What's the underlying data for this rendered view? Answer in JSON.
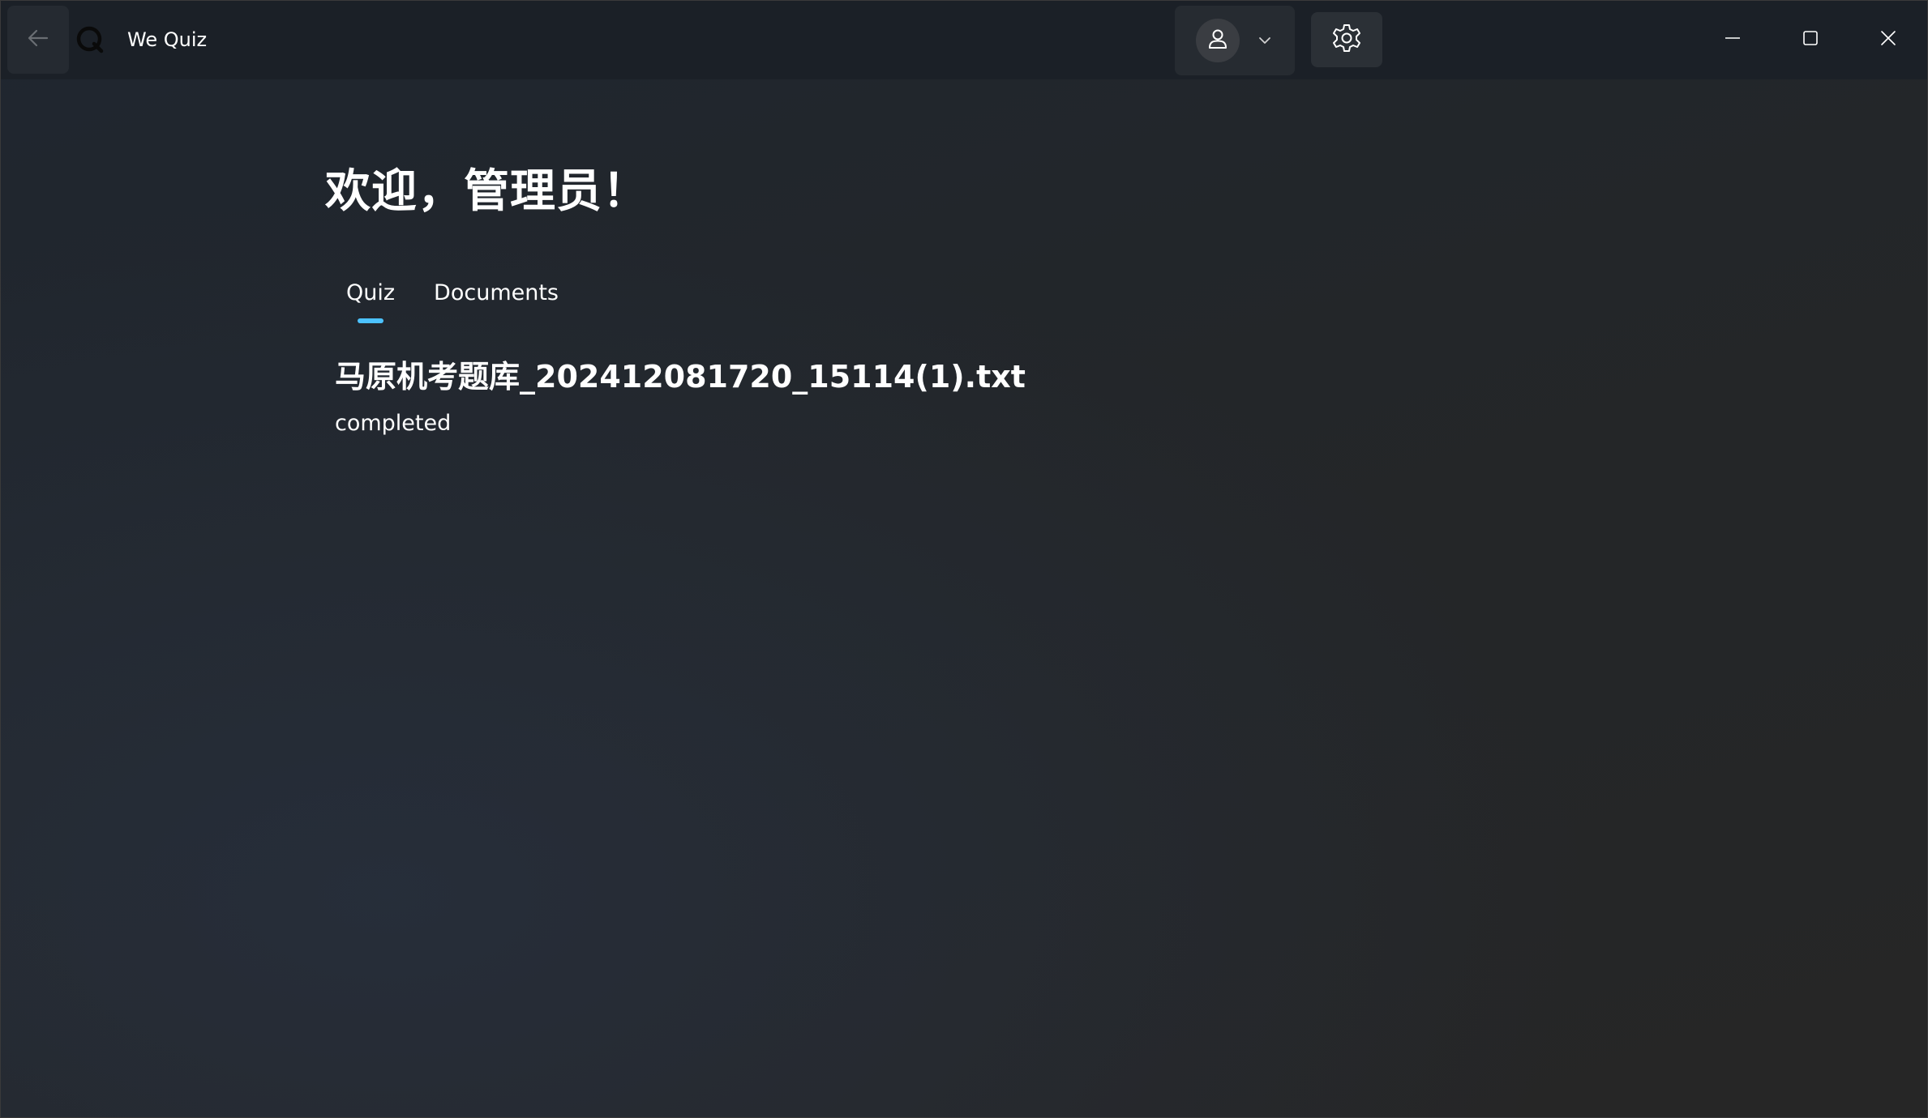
{
  "titlebar": {
    "app_title": "We Quiz",
    "icons": {
      "back": "back-arrow-icon",
      "app": "quiz-logo-icon",
      "user": "person-icon",
      "chevron": "chevron-down-icon",
      "settings": "gear-icon",
      "minimize": "minimize-icon",
      "maximize": "maximize-icon",
      "close": "close-icon"
    }
  },
  "main": {
    "welcome": "欢迎，管理员！",
    "tabs": [
      {
        "label": "Quiz",
        "selected": true
      },
      {
        "label": "Documents",
        "selected": false
      }
    ],
    "quizzes": [
      {
        "name": "马原机考题库_202412081720_15114(1).txt",
        "status": "completed"
      }
    ]
  },
  "colors": {
    "accent": "#4cc2ff",
    "titlebar_bg": "#1b2027",
    "text": "#ffffff"
  }
}
